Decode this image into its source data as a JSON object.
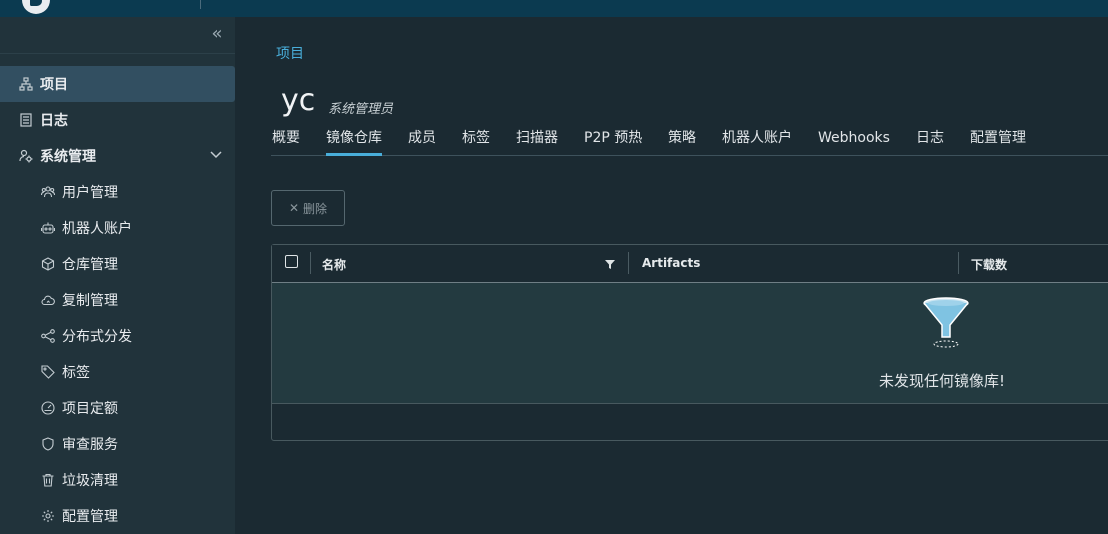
{
  "sidebar": {
    "items": [
      {
        "label": "项目",
        "icon": "project-icon"
      },
      {
        "label": "日志",
        "icon": "logs-icon"
      },
      {
        "label": "系统管理",
        "icon": "admin-settings-icon"
      },
      {
        "label": "用户管理",
        "icon": "users-icon"
      },
      {
        "label": "机器人账户",
        "icon": "robot-icon"
      },
      {
        "label": "仓库管理",
        "icon": "registry-box-icon"
      },
      {
        "label": "复制管理",
        "icon": "replication-cloud-icon"
      },
      {
        "label": "分布式分发",
        "icon": "share-icon"
      },
      {
        "label": "标签",
        "icon": "tag-icon"
      },
      {
        "label": "项目定额",
        "icon": "quota-dashboard-icon"
      },
      {
        "label": "审查服务",
        "icon": "shield-icon"
      },
      {
        "label": "垃圾清理",
        "icon": "trash-icon"
      },
      {
        "label": "配置管理",
        "icon": "gear-icon"
      }
    ]
  },
  "breadcrumb": "项目",
  "project": {
    "name": "yc",
    "role": "系统管理员"
  },
  "tabs": [
    "概要",
    "镜像仓库",
    "成员",
    "标签",
    "扫描器",
    "P2P 预热",
    "策略",
    "机器人账户",
    "Webhooks",
    "日志",
    "配置管理"
  ],
  "active_tab": "镜像仓库",
  "toolbar": {
    "delete_label": "删除"
  },
  "grid": {
    "columns": [
      "名称",
      "Artifacts",
      "下载数"
    ],
    "empty_text": "未发现任何镜像库!"
  },
  "colors": {
    "accent": "#49aeda",
    "sidebar_bg": "#21333b",
    "active_item": "#324f61",
    "header": "#0b3a50"
  }
}
